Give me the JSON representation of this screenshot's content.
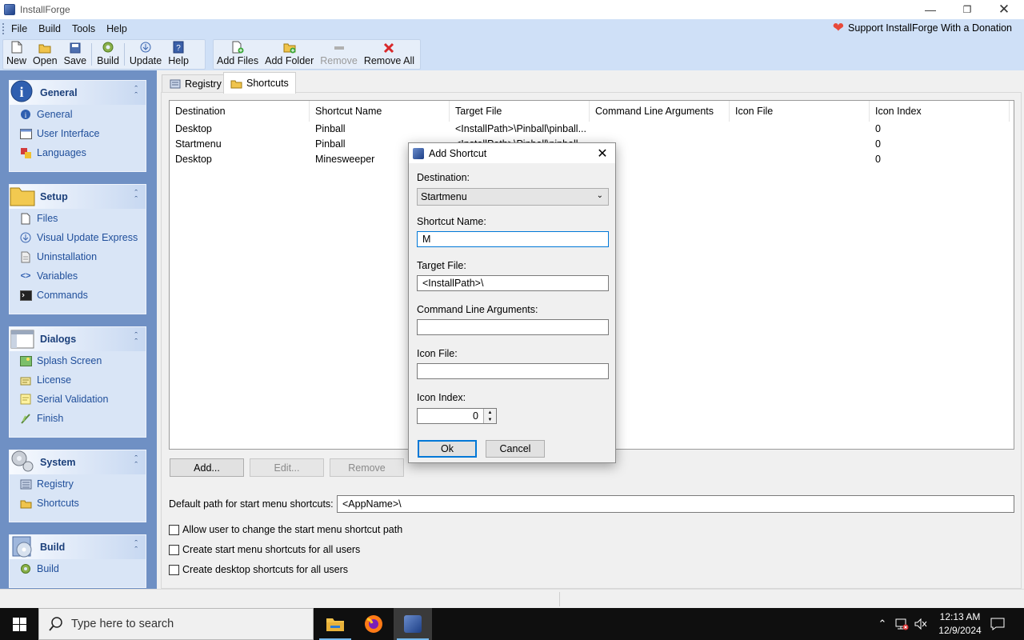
{
  "window": {
    "title": "InstallForge"
  },
  "menu": [
    "File",
    "Build",
    "Tools",
    "Help"
  ],
  "donate_label": "Support InstallForge With a Donation",
  "toolbar1": [
    {
      "label": "New",
      "icon": "new-file-icon"
    },
    {
      "label": "Open",
      "icon": "open-folder-icon"
    },
    {
      "label": "Save",
      "icon": "save-icon"
    },
    {
      "label": "Build",
      "icon": "build-gear-icon"
    },
    {
      "label": "Update",
      "icon": "update-icon"
    },
    {
      "label": "Help",
      "icon": "help-book-icon"
    }
  ],
  "toolbar2": [
    {
      "label": "Add Files",
      "icon": "add-files-icon",
      "disabled": false
    },
    {
      "label": "Add Folder",
      "icon": "add-folder-icon",
      "disabled": false
    },
    {
      "label": "Remove",
      "icon": "remove-icon",
      "disabled": true
    },
    {
      "label": "Remove All",
      "icon": "remove-all-icon",
      "disabled": false
    }
  ],
  "sidebar": {
    "panels": [
      {
        "title": "General",
        "items": [
          "General",
          "User Interface",
          "Languages"
        ]
      },
      {
        "title": "Setup",
        "items": [
          "Files",
          "Visual Update Express",
          "Uninstallation",
          "Variables",
          "Commands"
        ]
      },
      {
        "title": "Dialogs",
        "items": [
          "Splash Screen",
          "License",
          "Serial Validation",
          "Finish"
        ]
      },
      {
        "title": "System",
        "items": [
          "Registry",
          "Shortcuts"
        ]
      },
      {
        "title": "Build",
        "items": [
          "Build"
        ]
      }
    ]
  },
  "tabs": [
    {
      "label": "Registry"
    },
    {
      "label": "Shortcuts"
    }
  ],
  "grid": {
    "columns": [
      "Destination",
      "Shortcut Name",
      "Target File",
      "Command Line Arguments",
      "Icon File",
      "Icon Index"
    ],
    "rows": [
      [
        "Desktop",
        "Pinball",
        "<InstallPath>\\Pinball\\pinball...",
        "",
        "",
        "0"
      ],
      [
        "Startmenu",
        "Pinball",
        "<InstallPath>\\Pinball\\pinball...",
        "",
        "",
        "0"
      ],
      [
        "Desktop",
        "Minesweeper",
        "",
        "",
        "",
        "0"
      ]
    ]
  },
  "buttons": {
    "add": "Add...",
    "edit": "Edit...",
    "remove": "Remove"
  },
  "default_path": {
    "label": "Default path for start menu shortcuts:",
    "value": "<AppName>\\"
  },
  "checkboxes": [
    {
      "label": "Allow user to change the start menu shortcut path",
      "checked": false
    },
    {
      "label": "Create start menu shortcuts for all users",
      "checked": false
    },
    {
      "label": "Create desktop shortcuts for all users",
      "checked": false
    }
  ],
  "dialog": {
    "title": "Add Shortcut",
    "destination_label": "Destination:",
    "destination_value": "Startmenu",
    "shortcut_name_label": "Shortcut Name:",
    "shortcut_name_value": "M",
    "target_file_label": "Target File:",
    "target_file_value": "<InstallPath>\\",
    "args_label": "Command Line Arguments:",
    "args_value": "",
    "icon_file_label": "Icon File:",
    "icon_file_value": "",
    "icon_index_label": "Icon Index:",
    "icon_index_value": "0",
    "ok": "Ok",
    "cancel": "Cancel"
  },
  "taskbar": {
    "search_placeholder": "Type here to search",
    "time": "12:13 AM",
    "date": "12/9/2024"
  },
  "colors": {
    "menubar": "#cfe0f7",
    "sidebar": "#6f90c4",
    "panel_title": "#1b3f7a",
    "link": "#1f4e9a",
    "focus": "#0078d7"
  }
}
